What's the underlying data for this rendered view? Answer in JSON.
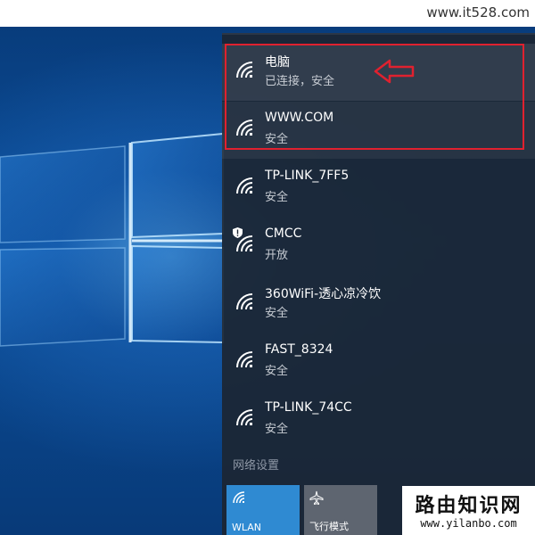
{
  "watermarks": {
    "top_url": "www.it528.com",
    "bottom_title": "路由知识网",
    "bottom_url": "www.yilanbo.com"
  },
  "network_flyout": {
    "networks": [
      {
        "name": "电脑",
        "status": "已连接，安全",
        "connected": true,
        "secured": true
      },
      {
        "name": "WWW.COM",
        "status": "安全",
        "connected": false,
        "secured": true
      },
      {
        "name": "TP-LINK_7FF5",
        "status": "安全",
        "connected": false,
        "secured": true
      },
      {
        "name": "CMCC",
        "status": "开放",
        "connected": false,
        "secured": false
      },
      {
        "name": "360WiFi-透心凉冷饮",
        "status": "安全",
        "connected": false,
        "secured": true
      },
      {
        "name": "FAST_8324",
        "status": "安全",
        "connected": false,
        "secured": true
      },
      {
        "name": "TP-LINK_74CC",
        "status": "安全",
        "connected": false,
        "secured": true
      }
    ],
    "settings_link": "网络设置",
    "tiles": {
      "wlan": {
        "label": "WLAN",
        "icon": "wifi-icon",
        "active": true
      },
      "airplane": {
        "label": "飞行模式",
        "icon": "airplane-icon",
        "active": false
      }
    }
  },
  "colors": {
    "accent": "#2f8ad2",
    "annotation": "#e0212f",
    "flyout_bg": "#1c2634"
  }
}
